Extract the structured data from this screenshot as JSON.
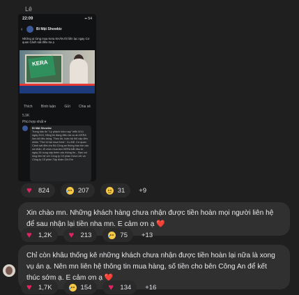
{
  "sender": {
    "name": "Lê"
  },
  "shared_screenshot": {
    "time": "22:09",
    "status_icons": "▪▪ 54",
    "page_name": "Bí Mật Showbiz",
    "caption": "Những ai từng mua Kera KHÂN thì liên lạc ngay Cơ quan Cảnh sát điều tra ạ",
    "pack_label": "KERA",
    "actions": [
      "Thích",
      "Bình luận",
      "Gửi",
      "Chia sẻ"
    ],
    "reaction_count": "5,9K",
    "sort_label": "Phù hợp nhất ▾",
    "comment_author": "Bí Mật Showbiz",
    "comment_text": "Trong bản tin \"Lý phách hôm nay\" hiển 5/14 ngày 20/4, Hãng tin đang điều tra vụ án KERA lừa dối tiêu dùng. Theo đó, toàn bộ đối cấp đến nhiều \"Thờ bị hại mua Kera\". Cụ thể, Cơ quan Cảnh sát điều tra Bộ Công an thông báo tìm các cá nhân, tổ chức mua kẹo KERA bắt đầu từ ngày 26 cung cấp thêm các thông tin... Bạn vui lòng liên hệ với Công ty Cổ phần Kera Life và Công ty Cổ phần Tập đoàn Chi Em"
  },
  "reactions_1": [
    {
      "emoji": "heart",
      "count": "824"
    },
    {
      "emoji": "sad",
      "count": "207"
    },
    {
      "emoji": "laugh",
      "count": "31"
    },
    {
      "emoji": "more",
      "count": "+9"
    }
  ],
  "message_1": {
    "text": "Xin chào mn. Những khách hàng chưa nhận được tiền hoàn mọi người liên hệ để sau nhận lại tiền nha mn. E cảm ơn ạ",
    "trailing_emoji": "❤️"
  },
  "reactions_2": [
    {
      "emoji": "heart",
      "count": "1,2K"
    },
    {
      "emoji": "heart",
      "count": "213"
    },
    {
      "emoji": "sad",
      "count": "75"
    },
    {
      "emoji": "more",
      "count": "+13"
    }
  ],
  "message_2": {
    "text": "Chỉ còn khâu thống kê những khách chưa nhận được tiền hoàn lại nữa là xong vụ án ạ. Nên mn liên hệ thông tin mua hàng, số tiền cho bên Công An để kết thúc sớm ạ. E cảm ơn ạ",
    "trailing_emoji": "❤️"
  },
  "reactions_3": [
    {
      "emoji": "heart",
      "count": "1,7K"
    },
    {
      "emoji": "sad",
      "count": "154"
    },
    {
      "emoji": "heart",
      "count": "134"
    },
    {
      "emoji": "more",
      "count": "+16"
    }
  ]
}
